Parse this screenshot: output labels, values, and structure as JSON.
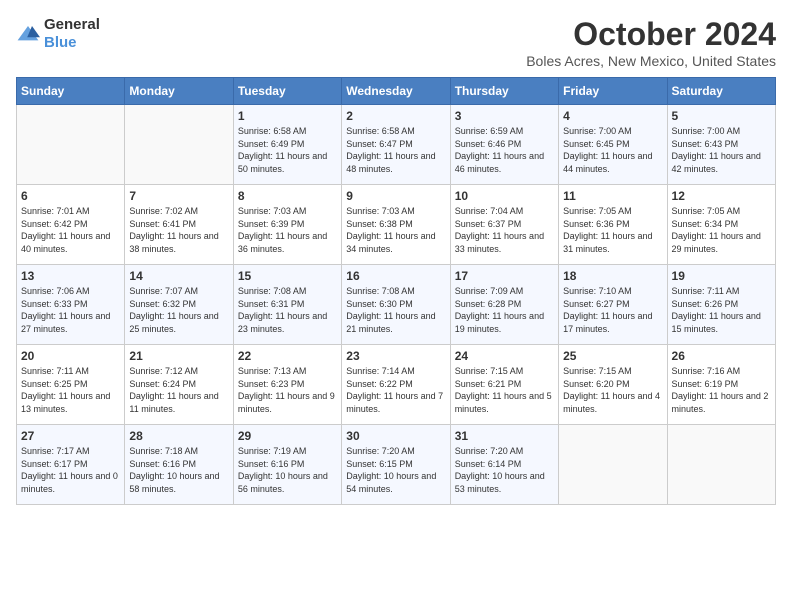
{
  "logo": {
    "general": "General",
    "blue": "Blue"
  },
  "title": "October 2024",
  "location": "Boles Acres, New Mexico, United States",
  "days_of_week": [
    "Sunday",
    "Monday",
    "Tuesday",
    "Wednesday",
    "Thursday",
    "Friday",
    "Saturday"
  ],
  "weeks": [
    [
      {
        "day": "",
        "info": ""
      },
      {
        "day": "",
        "info": ""
      },
      {
        "day": "1",
        "info": "Sunrise: 6:58 AM\nSunset: 6:49 PM\nDaylight: 11 hours and 50 minutes."
      },
      {
        "day": "2",
        "info": "Sunrise: 6:58 AM\nSunset: 6:47 PM\nDaylight: 11 hours and 48 minutes."
      },
      {
        "day": "3",
        "info": "Sunrise: 6:59 AM\nSunset: 6:46 PM\nDaylight: 11 hours and 46 minutes."
      },
      {
        "day": "4",
        "info": "Sunrise: 7:00 AM\nSunset: 6:45 PM\nDaylight: 11 hours and 44 minutes."
      },
      {
        "day": "5",
        "info": "Sunrise: 7:00 AM\nSunset: 6:43 PM\nDaylight: 11 hours and 42 minutes."
      }
    ],
    [
      {
        "day": "6",
        "info": "Sunrise: 7:01 AM\nSunset: 6:42 PM\nDaylight: 11 hours and 40 minutes."
      },
      {
        "day": "7",
        "info": "Sunrise: 7:02 AM\nSunset: 6:41 PM\nDaylight: 11 hours and 38 minutes."
      },
      {
        "day": "8",
        "info": "Sunrise: 7:03 AM\nSunset: 6:39 PM\nDaylight: 11 hours and 36 minutes."
      },
      {
        "day": "9",
        "info": "Sunrise: 7:03 AM\nSunset: 6:38 PM\nDaylight: 11 hours and 34 minutes."
      },
      {
        "day": "10",
        "info": "Sunrise: 7:04 AM\nSunset: 6:37 PM\nDaylight: 11 hours and 33 minutes."
      },
      {
        "day": "11",
        "info": "Sunrise: 7:05 AM\nSunset: 6:36 PM\nDaylight: 11 hours and 31 minutes."
      },
      {
        "day": "12",
        "info": "Sunrise: 7:05 AM\nSunset: 6:34 PM\nDaylight: 11 hours and 29 minutes."
      }
    ],
    [
      {
        "day": "13",
        "info": "Sunrise: 7:06 AM\nSunset: 6:33 PM\nDaylight: 11 hours and 27 minutes."
      },
      {
        "day": "14",
        "info": "Sunrise: 7:07 AM\nSunset: 6:32 PM\nDaylight: 11 hours and 25 minutes."
      },
      {
        "day": "15",
        "info": "Sunrise: 7:08 AM\nSunset: 6:31 PM\nDaylight: 11 hours and 23 minutes."
      },
      {
        "day": "16",
        "info": "Sunrise: 7:08 AM\nSunset: 6:30 PM\nDaylight: 11 hours and 21 minutes."
      },
      {
        "day": "17",
        "info": "Sunrise: 7:09 AM\nSunset: 6:28 PM\nDaylight: 11 hours and 19 minutes."
      },
      {
        "day": "18",
        "info": "Sunrise: 7:10 AM\nSunset: 6:27 PM\nDaylight: 11 hours and 17 minutes."
      },
      {
        "day": "19",
        "info": "Sunrise: 7:11 AM\nSunset: 6:26 PM\nDaylight: 11 hours and 15 minutes."
      }
    ],
    [
      {
        "day": "20",
        "info": "Sunrise: 7:11 AM\nSunset: 6:25 PM\nDaylight: 11 hours and 13 minutes."
      },
      {
        "day": "21",
        "info": "Sunrise: 7:12 AM\nSunset: 6:24 PM\nDaylight: 11 hours and 11 minutes."
      },
      {
        "day": "22",
        "info": "Sunrise: 7:13 AM\nSunset: 6:23 PM\nDaylight: 11 hours and 9 minutes."
      },
      {
        "day": "23",
        "info": "Sunrise: 7:14 AM\nSunset: 6:22 PM\nDaylight: 11 hours and 7 minutes."
      },
      {
        "day": "24",
        "info": "Sunrise: 7:15 AM\nSunset: 6:21 PM\nDaylight: 11 hours and 5 minutes."
      },
      {
        "day": "25",
        "info": "Sunrise: 7:15 AM\nSunset: 6:20 PM\nDaylight: 11 hours and 4 minutes."
      },
      {
        "day": "26",
        "info": "Sunrise: 7:16 AM\nSunset: 6:19 PM\nDaylight: 11 hours and 2 minutes."
      }
    ],
    [
      {
        "day": "27",
        "info": "Sunrise: 7:17 AM\nSunset: 6:17 PM\nDaylight: 11 hours and 0 minutes."
      },
      {
        "day": "28",
        "info": "Sunrise: 7:18 AM\nSunset: 6:16 PM\nDaylight: 10 hours and 58 minutes."
      },
      {
        "day": "29",
        "info": "Sunrise: 7:19 AM\nSunset: 6:16 PM\nDaylight: 10 hours and 56 minutes."
      },
      {
        "day": "30",
        "info": "Sunrise: 7:20 AM\nSunset: 6:15 PM\nDaylight: 10 hours and 54 minutes."
      },
      {
        "day": "31",
        "info": "Sunrise: 7:20 AM\nSunset: 6:14 PM\nDaylight: 10 hours and 53 minutes."
      },
      {
        "day": "",
        "info": ""
      },
      {
        "day": "",
        "info": ""
      }
    ]
  ]
}
